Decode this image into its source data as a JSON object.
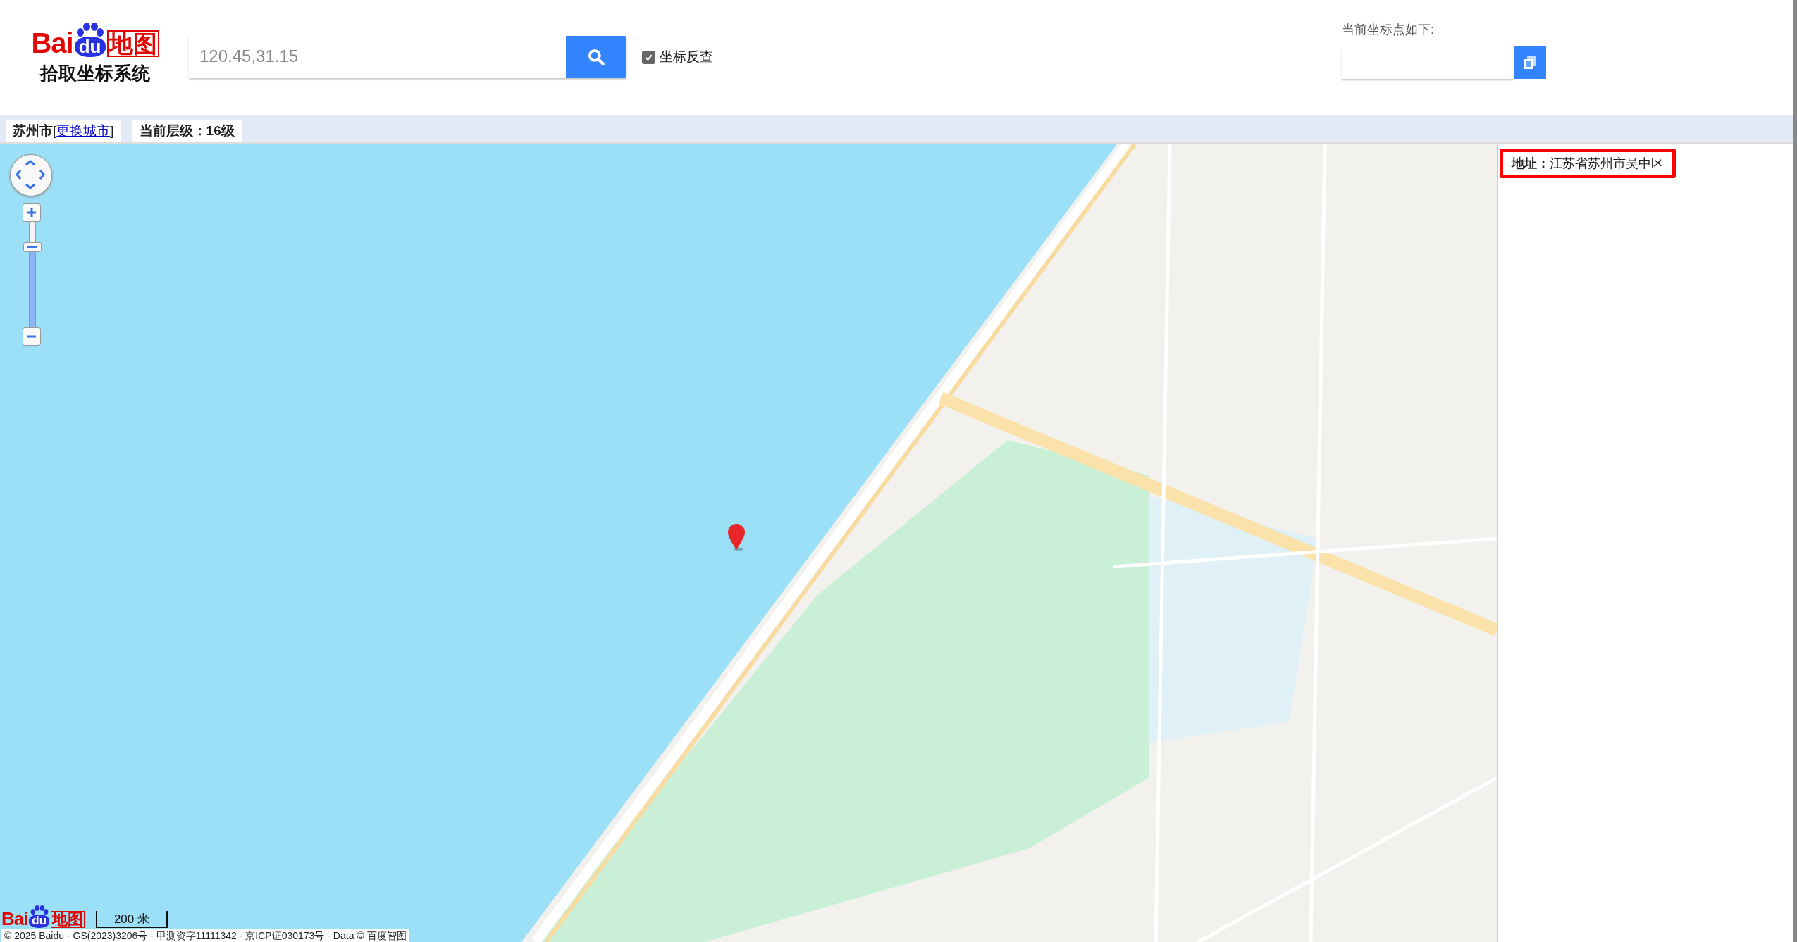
{
  "logo": {
    "latin": "Bai",
    "paw": "du",
    "cn": "地图",
    "subtitle": "拾取坐标系统"
  },
  "search": {
    "value": "120.45,31.15"
  },
  "reverse_lookup": {
    "label": "坐标反查",
    "checked": true
  },
  "current_point": {
    "label": "当前坐标点如下:"
  },
  "tabs": {
    "city": "苏州市",
    "open": "[",
    "link": "更换城市",
    "close": "]",
    "zoom_level": "当前层级：16级"
  },
  "address": "**地址：**江苏省苏州市吴中区",
  "map": {
    "zoom": {
      "level": 0.77
    },
    "scale": "200 米",
    "logo": {
      "latin": "Bai",
      "paw": "du",
      "cn": "地图"
    },
    "copyright": "© 2025 Baidu - GS(2023)3206号 - 甲测资字11111342 - 京ICP证030173号 - Data © 百度智图"
  }
}
